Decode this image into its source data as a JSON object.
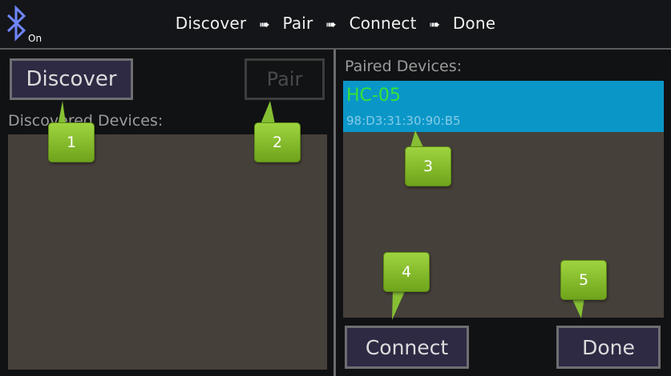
{
  "status_bar": {
    "bluetooth_icon": "bluetooth-icon",
    "bluetooth_state": "On",
    "steps": [
      "Discover",
      "Pair",
      "Connect",
      "Done"
    ],
    "step_separator": "➠"
  },
  "left_panel": {
    "discover_button": "Discover",
    "pair_button": "Pair",
    "discovered_label": "Discovered Devices:",
    "discovered_devices": []
  },
  "right_panel": {
    "paired_label": "Paired Devices:",
    "paired_devices": [
      {
        "name": "HC-05",
        "address": "98:D3:31:30:90:B5"
      }
    ],
    "connect_button": "Connect",
    "done_button": "Done"
  },
  "callouts": [
    "1",
    "2",
    "3",
    "4",
    "5"
  ],
  "colors": {
    "background": "#111214",
    "button_bg": "#2e2a44",
    "list_bg": "#46403a",
    "selected_bg": "#0a97c8",
    "device_name": "#39e236",
    "callout_green": "#8cc63f"
  }
}
